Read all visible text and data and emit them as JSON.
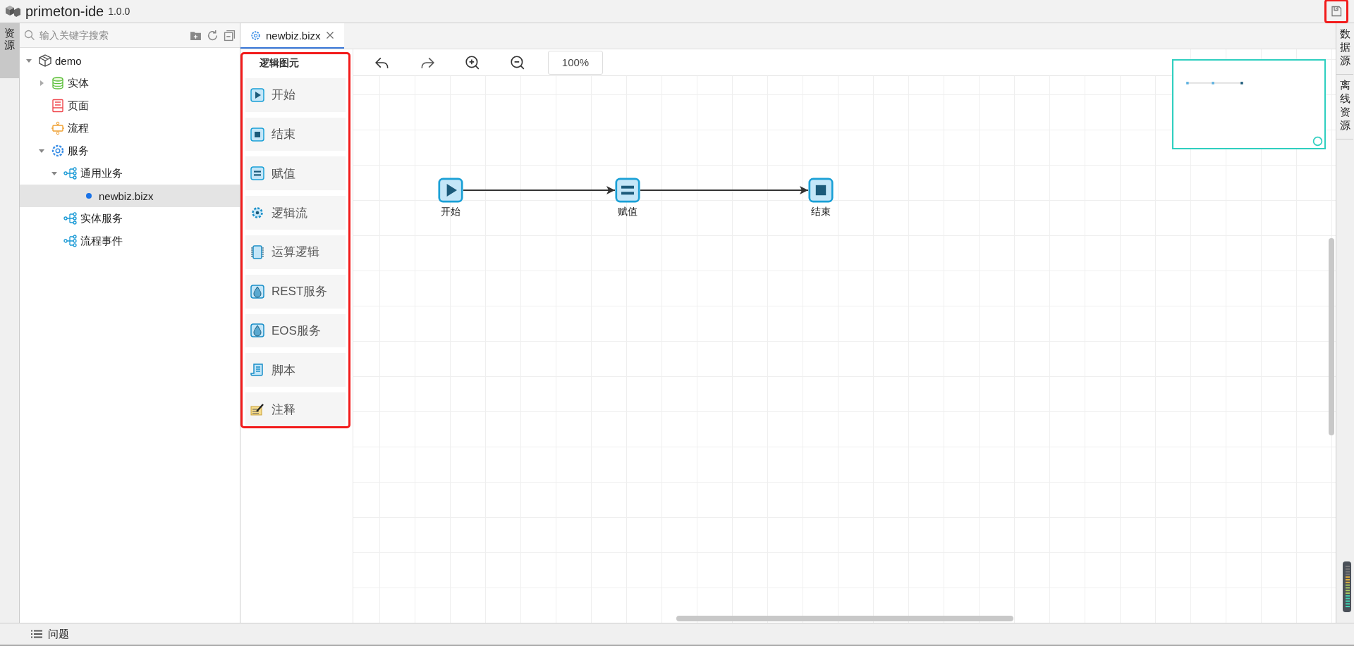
{
  "app": {
    "title": "primeton-ide",
    "version": "1.0.0"
  },
  "left_tabs": [
    {
      "label": "资源",
      "selected": true
    }
  ],
  "explorer": {
    "search": {
      "placeholder": "输入关键字搜索"
    },
    "tree": [
      {
        "label": "demo",
        "kind": "package",
        "expanded": true,
        "selected": false,
        "children": [
          {
            "label": "实体",
            "kind": "database",
            "expanded": false,
            "selected": false
          },
          {
            "label": "页面",
            "kind": "page",
            "selected": false
          },
          {
            "label": "流程",
            "kind": "flow",
            "selected": false
          },
          {
            "label": "服务",
            "kind": "gear",
            "expanded": true,
            "selected": false,
            "children": [
              {
                "label": "通用业务",
                "kind": "branch",
                "expanded": true,
                "selected": false,
                "children": [
                  {
                    "label": "newbiz.bizx",
                    "kind": "file",
                    "selected": true
                  }
                ]
              },
              {
                "label": "实体服务",
                "kind": "branch",
                "selected": false
              },
              {
                "label": "流程事件",
                "kind": "branch",
                "selected": false
              }
            ]
          }
        ]
      }
    ]
  },
  "editor_tabs": [
    {
      "label": "newbiz.bizx",
      "selected": true
    }
  ],
  "palette": {
    "title": "逻辑图元",
    "items": [
      {
        "label": "开始",
        "kind": "start"
      },
      {
        "label": "结束",
        "kind": "end"
      },
      {
        "label": "赋值",
        "kind": "assign"
      },
      {
        "label": "逻辑流",
        "kind": "gear"
      },
      {
        "label": "运算逻辑",
        "kind": "chip"
      },
      {
        "label": "REST服务",
        "kind": "rest"
      },
      {
        "label": "EOS服务",
        "kind": "eos"
      },
      {
        "label": "脚本",
        "kind": "script"
      },
      {
        "label": "注释",
        "kind": "note"
      }
    ]
  },
  "toolbar": {
    "zoom": "100%"
  },
  "diagram": {
    "nodes": [
      {
        "label": "开始",
        "kind": "start"
      },
      {
        "label": "赋值",
        "kind": "assign"
      },
      {
        "label": "结束",
        "kind": "end"
      }
    ]
  },
  "right_tabs": [
    {
      "label": "数据源",
      "selected": false
    },
    {
      "label": "离线资源",
      "selected": false
    }
  ],
  "status_bar": {
    "label": "问题"
  }
}
